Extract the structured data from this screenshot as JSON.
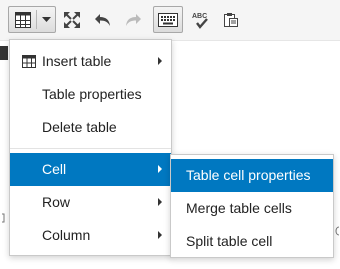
{
  "toolbar": {
    "icons": [
      "table-icon",
      "fullscreen-icon",
      "undo-icon",
      "redo-icon",
      "keyboard-icon",
      "spellcheck-icon",
      "paste-icon"
    ],
    "spellcheck_text": "ABC"
  },
  "menu": {
    "items": [
      {
        "label": "Insert table",
        "icon": "table-icon",
        "submenu": true
      },
      {
        "label": "Table properties",
        "submenu": false
      },
      {
        "label": "Delete table",
        "submenu": false
      },
      {
        "label": "Cell",
        "submenu": true,
        "active": true
      },
      {
        "label": "Row",
        "submenu": true
      },
      {
        "label": "Column",
        "submenu": true
      }
    ]
  },
  "submenu": {
    "items": [
      {
        "label": "Table cell properties",
        "active": true
      },
      {
        "label": "Merge table cells"
      },
      {
        "label": "Split table cell"
      }
    ]
  },
  "colors": {
    "active": "#0078c1",
    "menu_bg": "#ffffff",
    "toolbar_bg": "#f5f5f5"
  }
}
